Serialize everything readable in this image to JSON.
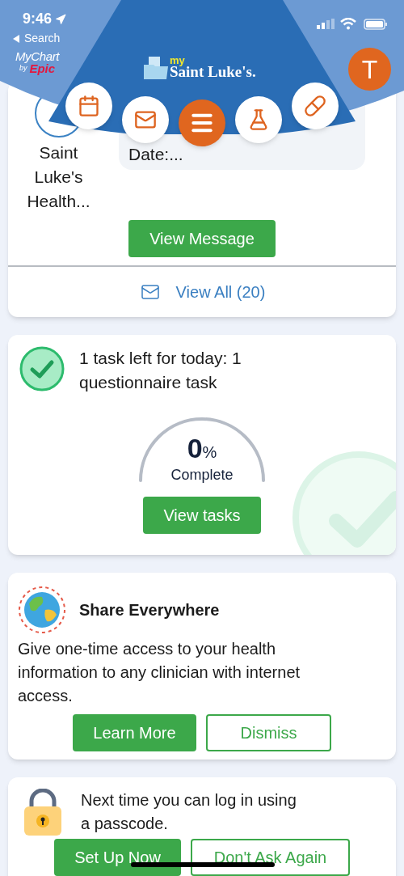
{
  "status_bar": {
    "time": "9:46",
    "back_label": "Search"
  },
  "header": {
    "brand": {
      "name": "MyChart",
      "by": "by",
      "vendor": "Epic"
    },
    "portal_logo": {
      "prefix": "my",
      "name": "Saint Luke's."
    },
    "avatar": "T"
  },
  "nav": [
    {
      "kind": "calendar"
    },
    {
      "kind": "mail"
    },
    {
      "kind": "menu"
    },
    {
      "kind": "lab"
    },
    {
      "kind": "medication"
    }
  ],
  "message_card": {
    "sender": "Saint Luke's Health...",
    "preview": "Date:...",
    "button": "View Message",
    "view_all": "View All (20)"
  },
  "tasks_card": {
    "title": "1 task left for today: 1 questionnaire task",
    "progress": {
      "value": "0",
      "unit": "%",
      "label": "Complete"
    },
    "button": "View tasks"
  },
  "share_card": {
    "title": "Share Everywhere",
    "body": "Give one-time access to your health information to any clinician with internet access.",
    "buttons": [
      {
        "label": "Learn More",
        "kind": "primary"
      },
      {
        "label": "Dismiss",
        "kind": "secondary"
      }
    ]
  },
  "passcode_card": {
    "body": "Next time you can log in using a passcode.",
    "buttons": [
      {
        "label": "Set Up Now",
        "kind": "primary"
      },
      {
        "label": "Don't Ask Again",
        "kind": "secondary"
      }
    ]
  }
}
